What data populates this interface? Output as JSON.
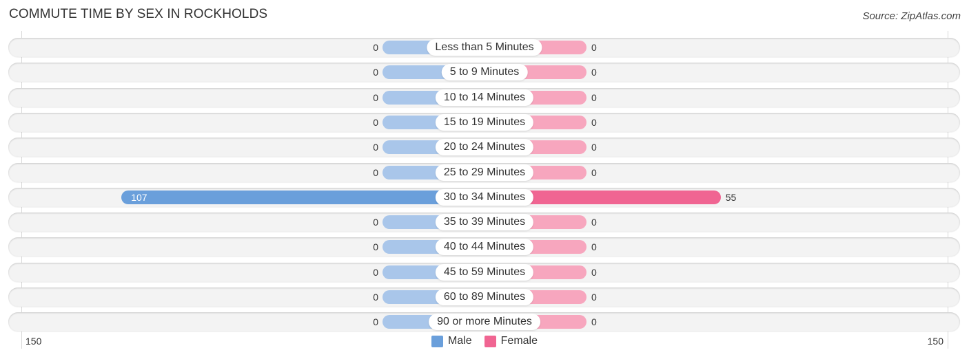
{
  "title": "COMMUTE TIME BY SEX IN ROCKHOLDS",
  "source": "Source: ZipAtlas.com",
  "colors": {
    "male": "#6a9fdb",
    "male_light": "#a9c6ea",
    "female": "#f06592",
    "female_light": "#f7a6be"
  },
  "chart_data": {
    "type": "bar",
    "orientation": "horizontal-diverging",
    "title": "COMMUTE TIME BY SEX IN ROCKHOLDS",
    "categories": [
      "Less than 5 Minutes",
      "5 to 9 Minutes",
      "10 to 14 Minutes",
      "15 to 19 Minutes",
      "20 to 24 Minutes",
      "25 to 29 Minutes",
      "30 to 34 Minutes",
      "35 to 39 Minutes",
      "40 to 44 Minutes",
      "45 to 59 Minutes",
      "60 to 89 Minutes",
      "90 or more Minutes"
    ],
    "series": [
      {
        "name": "Male",
        "values": [
          0,
          0,
          0,
          0,
          0,
          0,
          107,
          0,
          0,
          0,
          0,
          0
        ]
      },
      {
        "name": "Female",
        "values": [
          0,
          0,
          0,
          0,
          0,
          0,
          55,
          0,
          0,
          0,
          0,
          0
        ]
      }
    ],
    "axis": {
      "left_label": "150",
      "right_label": "150",
      "range": [
        0,
        150
      ]
    },
    "legend": {
      "position": "bottom-center",
      "entries": [
        "Male",
        "Female"
      ]
    },
    "grid": false
  }
}
